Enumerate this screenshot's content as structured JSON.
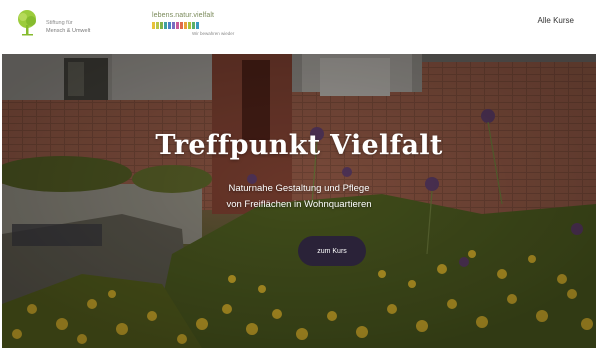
{
  "header": {
    "logo1": {
      "line1": "Stiftung für",
      "line2": "Mensch & Umwelt",
      "icon": "tree-logo-icon"
    },
    "logo2": {
      "line1": "lebens.natur.vielfalt",
      "line2": "Wir bewahren wieder",
      "colors": [
        "#e8c23a",
        "#b9c64a",
        "#7fb24a",
        "#3fa0a0",
        "#4a82c8",
        "#7a6cc0",
        "#c85a9a",
        "#e06a4a",
        "#e8a03a",
        "#a9c23a",
        "#5ab06a",
        "#3a9ac0"
      ]
    },
    "nav": {
      "all_courses": "Alle Kurse"
    }
  },
  "hero": {
    "title": "Treffpunkt Vielfalt",
    "subtitle_line1": "Naturnahe Gestaltung und Pflege",
    "subtitle_line2": "von Freiflächen in Wohnquartieren",
    "cta_label": "zum Kurs"
  }
}
